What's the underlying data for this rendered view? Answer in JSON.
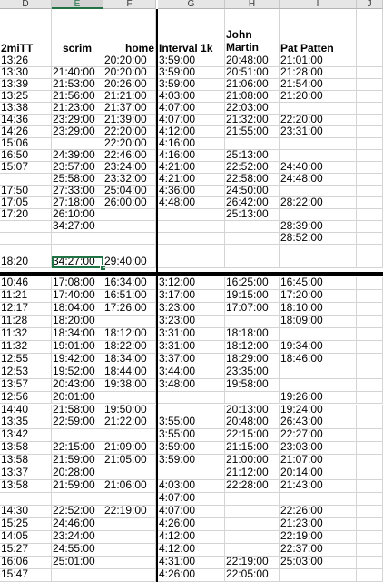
{
  "column_letters": [
    "D",
    "E",
    "F",
    "G",
    "H",
    "I",
    "J"
  ],
  "header": {
    "d": "2miTT",
    "e": "scrim",
    "f": "home",
    "g": "Interval 1k",
    "h_line1": "John",
    "h_line2": "Martin",
    "i": "Pat Patten"
  },
  "rows_top": [
    [
      "13:26",
      "",
      "20:20:00",
      "3:59:00",
      "20:48:00",
      "21:01:00"
    ],
    [
      "13:30",
      "21:40:00",
      "20:20:00",
      "3:59:00",
      "20:51:00",
      "21:28:00"
    ],
    [
      "13:39",
      "21:53:00",
      "20:26:00",
      "3:59:00",
      "21:06:00",
      "21:54:00"
    ],
    [
      "13:25",
      "21:56:00",
      "21:21:00",
      "4:03:00",
      "21:08:00",
      "21:20:00"
    ],
    [
      "13:38",
      "21:23:00",
      "21:37:00",
      "4:07:00",
      "22:03:00",
      ""
    ],
    [
      "14:36",
      "23:29:00",
      "21:39:00",
      "4:07:00",
      "21:32:00",
      "22:20:00"
    ],
    [
      "14:26",
      "23:29:00",
      "22:20:00",
      "4:12:00",
      "21:55:00",
      "23:31:00"
    ],
    [
      "15:06",
      "",
      "22:20:00",
      "4:16:00",
      "",
      ""
    ],
    [
      "16:50",
      "24:39:00",
      "22:46:00",
      "4:16:00",
      "25:13:00",
      ""
    ],
    [
      "15:07",
      "23:57:00",
      "23:24:00",
      "4:21:00",
      "22:52:00",
      "24:40:00"
    ],
    [
      "",
      "25:58:00",
      "23:32:00",
      "4:21:00",
      "22:58:00",
      "24:48:00"
    ],
    [
      "17:50",
      "27:33:00",
      "25:04:00",
      "4:36:00",
      "24:50:00",
      ""
    ],
    [
      "17:05",
      "27:18:00",
      "26:00:00",
      "4:48:00",
      "26:42:00",
      "28:22:00"
    ],
    [
      "17:20",
      "26:10:00",
      "",
      "",
      "25:13:00",
      ""
    ],
    [
      "",
      "34:27:00",
      "",
      "",
      "",
      "28:39:00"
    ],
    [
      "",
      "",
      "",
      "",
      "",
      "28:52:00"
    ],
    [
      "",
      "",
      "",
      "",
      "",
      ""
    ],
    [
      "18:20",
      "34:27:00",
      "29:40:00",
      "",
      "",
      ""
    ]
  ],
  "rows_bottom": [
    [
      "10:46",
      "17:08:00",
      "16:34:00",
      "3:12:00",
      "16:25:00",
      "16:45:00"
    ],
    [
      "11:21",
      "17:40:00",
      "16:51:00",
      "3:17:00",
      "19:15:00",
      "17:20:00"
    ],
    [
      "12:17",
      "18:04:00",
      "17:26:00",
      "3:23:00",
      "17:07:00",
      "18:10:00"
    ],
    [
      "11:28",
      "18:20:00",
      "",
      "3:23:00",
      "",
      "18:09:00"
    ],
    [
      "11:32",
      "18:34:00",
      "18:12:00",
      "3:31:00",
      "18:18:00",
      ""
    ],
    [
      "11:32",
      "19:01:00",
      "18:22:00",
      "3:31:00",
      "18:12:00",
      "19:34:00"
    ],
    [
      "12:55",
      "19:42:00",
      "18:34:00",
      "3:37:00",
      "18:29:00",
      "18:46:00"
    ],
    [
      "12:53",
      "19:52:00",
      "18:44:00",
      "3:44:00",
      "23:35:00",
      ""
    ],
    [
      "13:57",
      "20:43:00",
      "19:38:00",
      "3:48:00",
      "19:58:00",
      ""
    ],
    [
      "12:56",
      "20:01:00",
      "",
      "",
      "",
      "19:26:00"
    ],
    [
      "14:40",
      "21:58:00",
      "19:50:00",
      "",
      "20:13:00",
      "19:24:00"
    ],
    [
      "13:35",
      "22:59:00",
      "21:22:00",
      "3:55:00",
      "20:48:00",
      "26:43:00"
    ],
    [
      "13:42",
      "",
      "",
      "3:55:00",
      "22:15:00",
      "22:27:00"
    ],
    [
      "13:58",
      "22:15:00",
      "21:09:00",
      "3:59:00",
      "21:15:00",
      "23:03:00"
    ],
    [
      "13:58",
      "21:59:00",
      "21:05:00",
      "3:59:00",
      "21:00:00",
      "21:07:00"
    ],
    [
      "13:37",
      "20:28:00",
      "",
      "",
      "21:12:00",
      "20:14:00"
    ],
    [
      "13:58",
      "21:59:00",
      "21:06:00",
      "4:03:00",
      "22:28:00",
      "21:43:00"
    ],
    [
      "",
      "",
      "",
      "4:07:00",
      "",
      ""
    ],
    [
      "14:30",
      "22:52:00",
      "22:19:00",
      "4:07:00",
      "",
      "22:26:00"
    ],
    [
      "15:25",
      "24:46:00",
      "",
      "4:26:00",
      "",
      "21:23:00"
    ],
    [
      "14:05",
      "23:24:00",
      "",
      "4:12:00",
      "",
      "22:19:00"
    ],
    [
      "15:27",
      "24:55:00",
      "",
      "4:12:00",
      "",
      "22:37:00"
    ],
    [
      "16:06",
      "25:01:00",
      "",
      "4:31:00",
      "22:19:00",
      "25:03:00"
    ],
    [
      "15:47",
      "",
      "",
      "4:26:00",
      "22:05:00",
      ""
    ]
  ],
  "selected_cell_value": "34:27:00",
  "accent_color": "#217346"
}
